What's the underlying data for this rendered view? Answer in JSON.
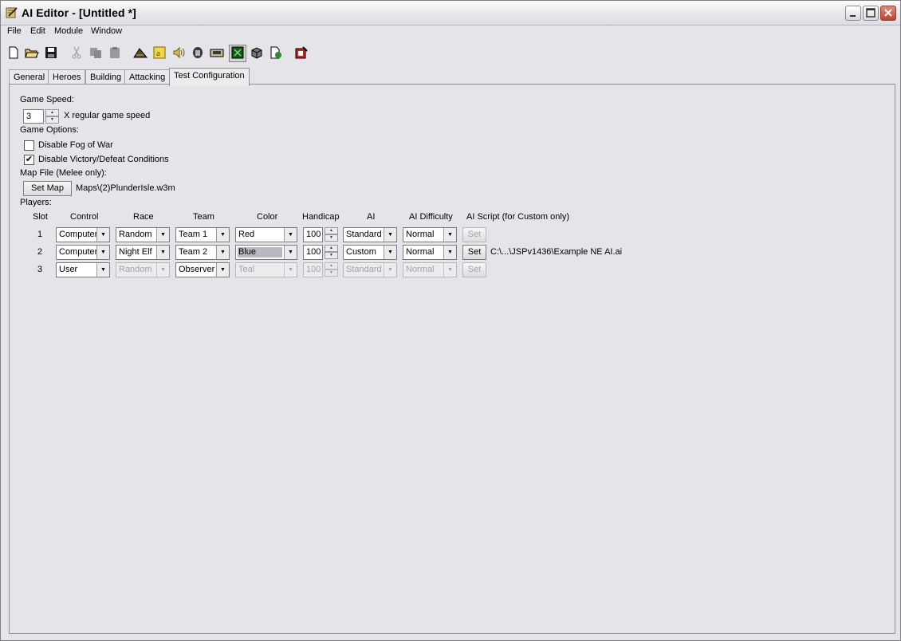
{
  "window": {
    "title": "AI Editor - [Untitled *]",
    "icon": "ai-editor-icon",
    "controls": [
      "minimize-icon",
      "maximize-icon",
      "close-icon"
    ]
  },
  "menu": [
    "File",
    "Edit",
    "Module",
    "Window"
  ],
  "toolbar": {
    "icons": [
      "new-file-icon",
      "open-folder-icon",
      "save-icon",
      "cut-icon",
      "copy-icon",
      "paste-icon",
      "terrain-icon",
      "gold-icon",
      "sound-icon",
      "hero-icon",
      "map-icon",
      "test-icon",
      "cube-icon",
      "export-icon",
      "settings-icon"
    ]
  },
  "tabs": [
    "General",
    "Heroes",
    "Building",
    "Attacking",
    "Test Configuration"
  ],
  "active_tab": "Test Configuration",
  "config": {
    "game_speed_label": "Game Speed:",
    "game_speed_value": "3",
    "game_speed_suffix": "X regular game speed",
    "game_options_label": "Game Options:",
    "fog_label": "Disable Fog of War",
    "fog_checked": false,
    "victory_label": "Disable Victory/Defeat Conditions",
    "victory_checked": true,
    "check_mark": "✔",
    "map_file_label": "Map File (Melee only):",
    "set_map_label": "Set Map",
    "map_path": "Maps\\(2)PlunderIsle.w3m",
    "players_label": "Players:"
  },
  "players_headers": [
    "Slot",
    "Control",
    "Race",
    "Team",
    "Color",
    "Handicap",
    "AI",
    "AI Difficulty",
    "AI Script (for Custom only)"
  ],
  "players": [
    {
      "slot": "1",
      "control": "Computer",
      "race": "Random",
      "team": "Team 1",
      "color": "Red",
      "handicap": "100",
      "ai": "Standard",
      "difficulty": "Normal",
      "set_label": "Set",
      "script": ""
    },
    {
      "slot": "2",
      "control": "Computer",
      "race": "Night Elf",
      "team": "Team 2",
      "color": "Blue",
      "handicap": "100",
      "ai": "Custom",
      "difficulty": "Normal",
      "set_label": "Set",
      "script": "C:\\...\\JSPv1436\\Example NE AI.ai"
    },
    {
      "slot": "3",
      "control": "User",
      "race": "Random",
      "team": "Observer",
      "color": "Teal",
      "handicap": "100",
      "ai": "Standard",
      "difficulty": "Normal",
      "set_label": "Set",
      "script": ""
    }
  ]
}
